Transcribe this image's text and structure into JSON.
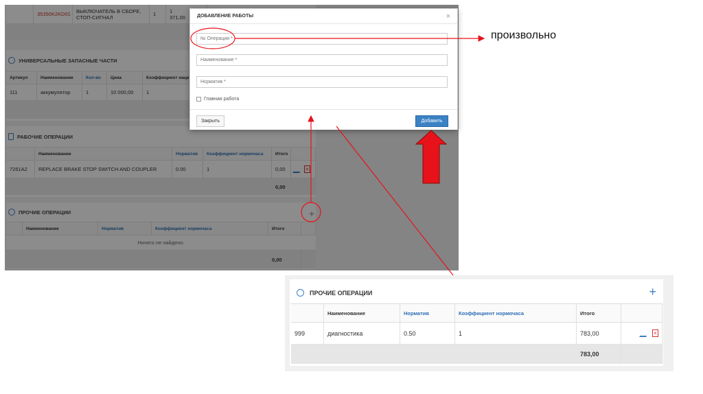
{
  "background": {
    "top_row": {
      "code": "35350K2KD01",
      "name_l1": "ВЫКЛЮЧАТЕЛЬ В СБОРЕ,",
      "name_l2": "СТОП-СИГНАЛ",
      "qty": "1",
      "price_l1": "1",
      "price_l2": "371,00"
    },
    "universal_parts": {
      "title": "УНИВЕРСАЛЬНЫЕ ЗАПАСНЫЕ ЧАСТИ",
      "headers": [
        "Артикул",
        "Наименование",
        "Кол-во",
        "Цена",
        "Коэффициент наценк"
      ],
      "row": [
        "111",
        "аккумулятор",
        "1",
        "10 000,00",
        "1"
      ]
    },
    "work_ops": {
      "title": "РАБОЧИЕ ОПЕРАЦИИ",
      "headers": [
        "Наименование",
        "Норматив",
        "Коэффициент нормочаса",
        "Итого"
      ],
      "row": [
        "7261A2",
        "REPLACE BRAKE STOP SWITCH AND COUPLER",
        "0.00",
        "1",
        "0,00"
      ],
      "total": "0,00"
    },
    "other_ops": {
      "title": "ПРОЧИЕ ОПЕРАЦИИ",
      "headers": [
        "Наименование",
        "Норматив",
        "Коэффициент нормочаса",
        "Итого"
      ],
      "empty": "Ничего не найдено.",
      "total": "0,00",
      "plus": "+"
    }
  },
  "modal": {
    "title": "ДОБАВЛЕНИЕ РАБОТЫ",
    "close_glyph": "×",
    "op_number_placeholder": "№ Операции *",
    "name_placeholder": "Наименование *",
    "norm_placeholder": "Норматив *",
    "main_work_label": "Главная работа",
    "close_button": "Закрыть",
    "add_button": "Добавить"
  },
  "annotation": {
    "text": "произвольно"
  },
  "inset": {
    "title": "ПРОЧИЕ ОПЕРАЦИИ",
    "plus": "+",
    "headers": [
      "Наименование",
      "Норматив",
      "Коэффициент нормочаса",
      "Итого"
    ],
    "row": {
      "code": "999",
      "name": "диагностика",
      "norm": "0.50",
      "coef": "1",
      "total": "783,00"
    },
    "footer_total": "783,00",
    "delete_glyph": "×"
  },
  "colors": {
    "accent": "#3b82c4",
    "annotation_red": "#e8121a",
    "code_red": "#c0392b"
  },
  "icons": [
    "close-icon",
    "gear-icon",
    "document-icon",
    "plus-icon",
    "edit-icon",
    "delete-icon",
    "arrow-up-icon"
  ]
}
